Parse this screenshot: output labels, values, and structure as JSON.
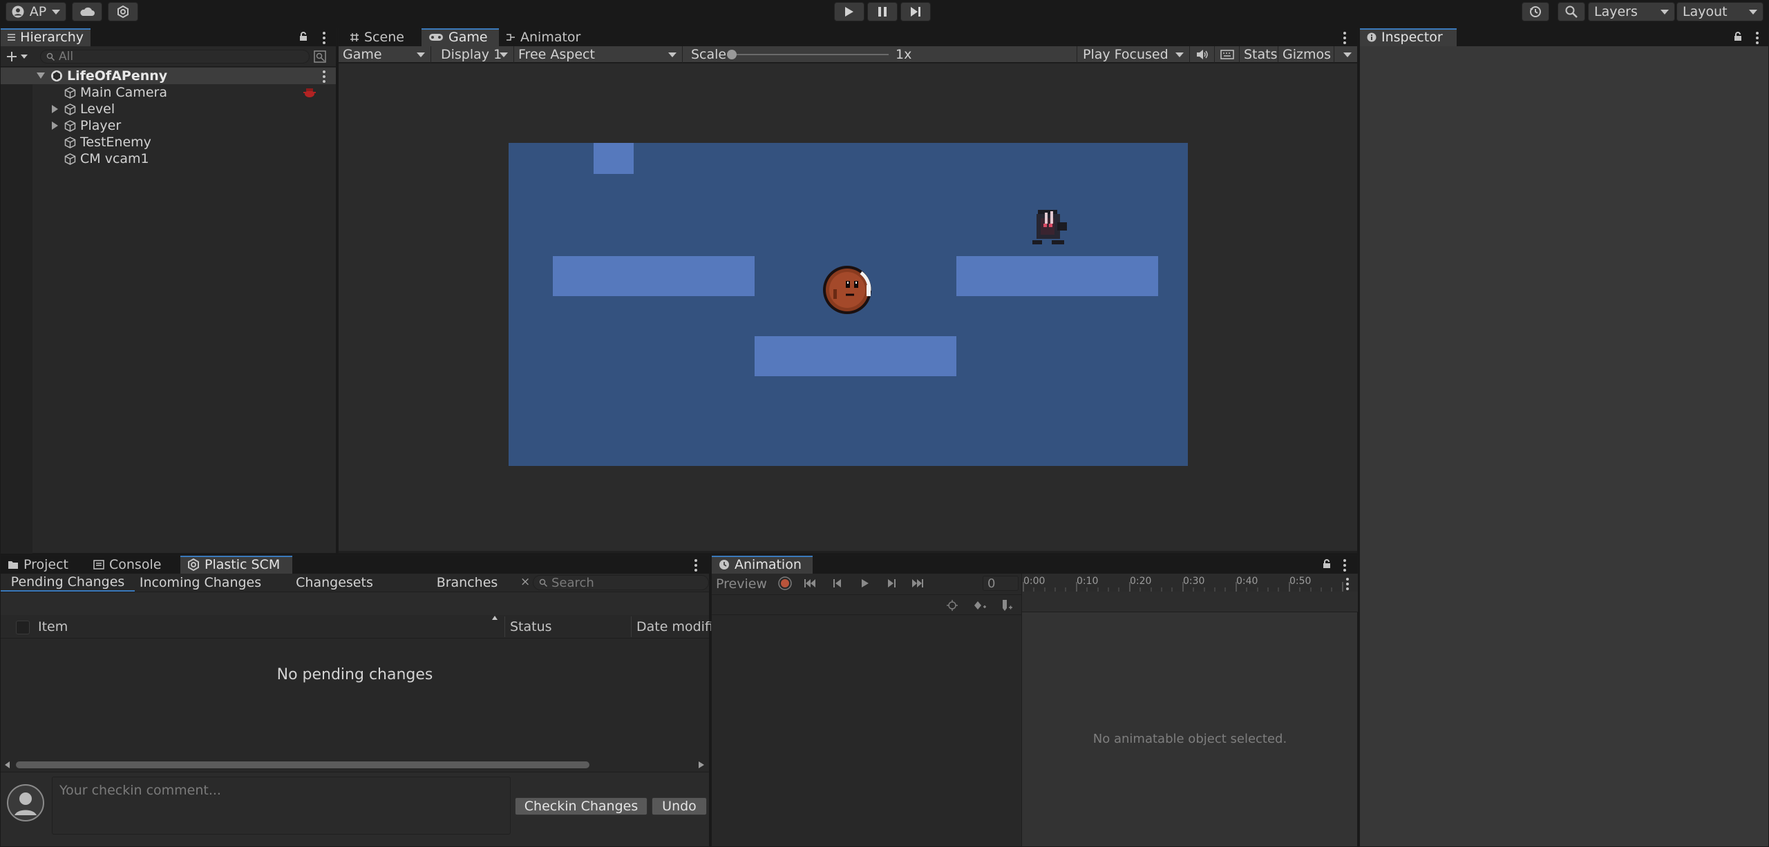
{
  "toolbar": {
    "account_label": "AP",
    "layers_label": "Layers",
    "layout_label": "Layout"
  },
  "hierarchy": {
    "tab_label": "Hierarchy",
    "search_placeholder": "All",
    "scene_name": "LifeOfAPenny",
    "items": [
      {
        "label": "Main Camera",
        "has_children": false
      },
      {
        "label": "Level",
        "has_children": true
      },
      {
        "label": "Player",
        "has_children": true
      },
      {
        "label": "TestEnemy",
        "has_children": false
      },
      {
        "label": "CM vcam1",
        "has_children": false
      }
    ]
  },
  "center": {
    "tabs": [
      {
        "label": "Scene",
        "icon": "hash-icon"
      },
      {
        "label": "Game",
        "icon": "gamepad-icon"
      },
      {
        "label": "Animator",
        "icon": "animator-icon"
      }
    ],
    "active_tab": "Game",
    "gamebar": {
      "view_select": "Game",
      "display_select": "Display 1",
      "aspect_select": "Free Aspect",
      "scale_label": "Scale",
      "scale_value": "1x",
      "play_mode_select": "Play Focused",
      "stats_label": "Stats",
      "gizmos_label": "Gizmos"
    },
    "game_colors": {
      "background": "#34527f",
      "platform": "#5679bd"
    }
  },
  "inspector": {
    "tab_label": "Inspector"
  },
  "bottom_left": {
    "tabs": [
      {
        "label": "Project",
        "icon": "folder-icon"
      },
      {
        "label": "Console",
        "icon": "console-icon"
      },
      {
        "label": "Plastic SCM",
        "icon": "plastic-icon"
      }
    ],
    "subtabs": [
      "Pending Changes",
      "Incoming Changes",
      "Changesets",
      "Branches"
    ],
    "search_placeholder": "Search",
    "columns": [
      "Item",
      "Status",
      "Date modifie"
    ],
    "empty_message": "No pending changes",
    "comment_placeholder": "Your checkin comment...",
    "checkin_label": "Checkin Changes",
    "undo_label": "Undo"
  },
  "animation": {
    "tab_label": "Animation",
    "preview_label": "Preview",
    "frame_value": "0",
    "ruler": [
      "0:00",
      "0:10",
      "0:20",
      "0:30",
      "0:40",
      "0:50"
    ],
    "empty_message": "No animatable object selected."
  }
}
